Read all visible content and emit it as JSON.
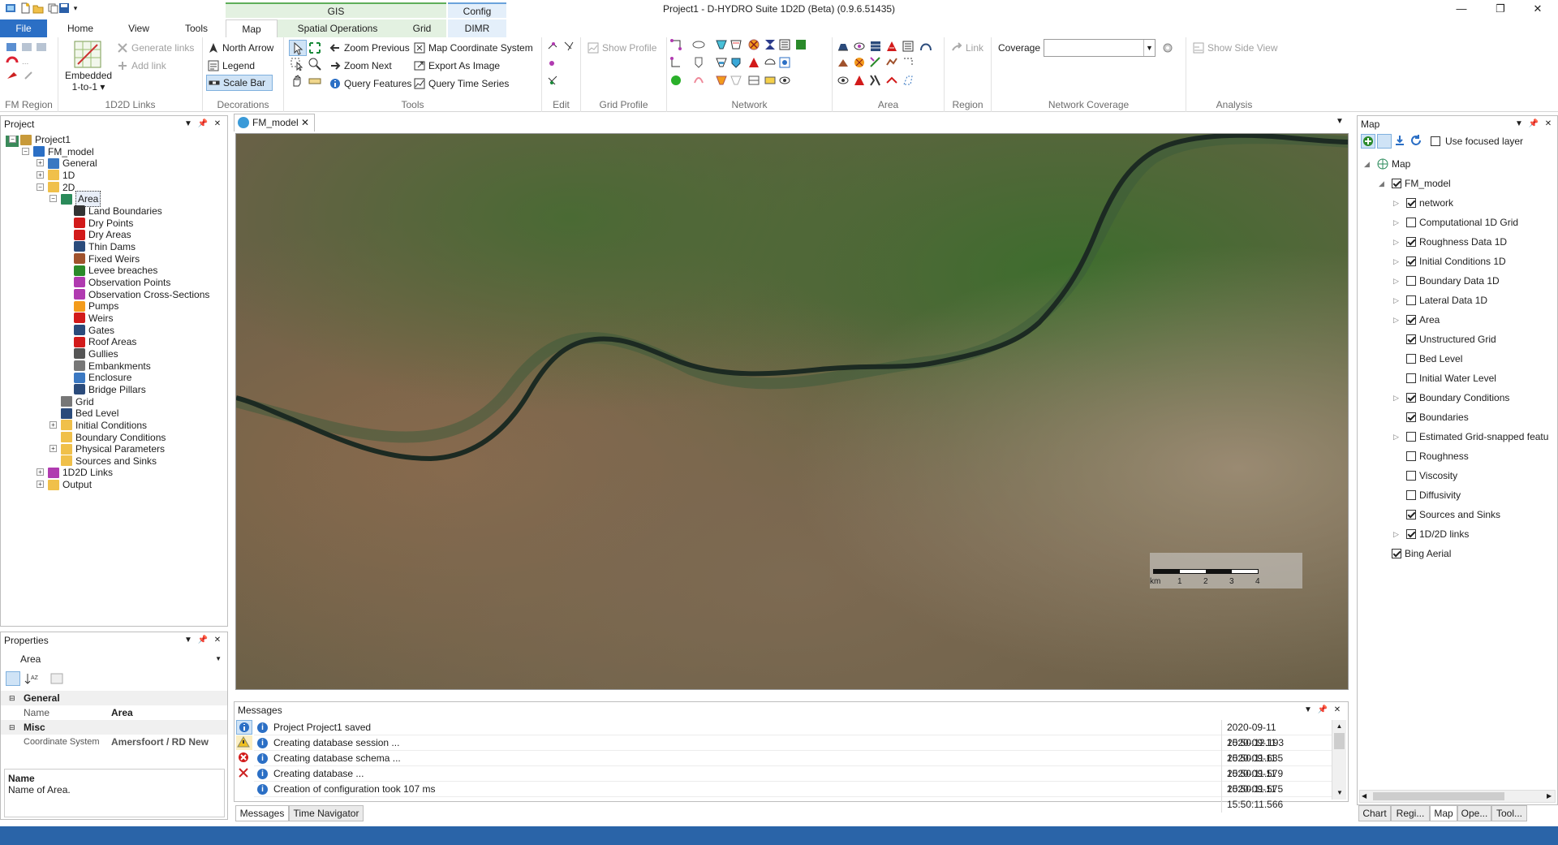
{
  "app": {
    "title": "Project1 - D-HYDRO Suite 1D2D (Beta) (0.9.6.51435)"
  },
  "window": {
    "minimize": "—",
    "restore": "❐",
    "close": "✕"
  },
  "ribbon": {
    "tabs": {
      "file": "File",
      "home": "Home",
      "view": "View",
      "tools": "Tools",
      "map": "Map",
      "spatial": "Spatial Operations",
      "grid": "Grid",
      "dimr": "DIMR"
    },
    "context": {
      "gis": "GIS",
      "config": "Config"
    },
    "groups": {
      "fm_region": "FM Region",
      "links": "1D2D Links",
      "decorations": "Decorations",
      "tools": "Tools",
      "edit": "Edit",
      "grid_profile": "Grid Profile",
      "network": "Network",
      "area": "Area",
      "region": "Region",
      "network_coverage": "Network Coverage",
      "analysis": "Analysis"
    },
    "links": {
      "embedded": "Embedded",
      "one_to_one": "1-to-1 ▾",
      "generate": "Generate links",
      "add": "Add link"
    },
    "decorations": {
      "north_arrow": "North Arrow",
      "legend": "Legend",
      "scale_bar": "Scale Bar"
    },
    "tools": {
      "zoom_previous": "Zoom Previous",
      "zoom_next": "Zoom Next",
      "query_features": "Query Features",
      "map_coord": "Map Coordinate System",
      "export_image": "Export As Image",
      "query_time": "Query Time Series"
    },
    "grid_profile": {
      "show_profile": "Show Profile"
    },
    "region": {
      "link": "Link"
    },
    "coverage": {
      "label": "Coverage",
      "value": ""
    },
    "analysis": {
      "show_side_view": "Show Side View"
    }
  },
  "project": {
    "title": "Project",
    "nodes": [
      {
        "label": "Project1"
      },
      {
        "label": "FM_model"
      },
      {
        "label": "General"
      },
      {
        "label": "1D"
      },
      {
        "label": "2D"
      },
      {
        "label": "Area"
      },
      {
        "label": "Land Boundaries"
      },
      {
        "label": "Dry Points"
      },
      {
        "label": "Dry Areas"
      },
      {
        "label": "Thin Dams"
      },
      {
        "label": "Fixed Weirs"
      },
      {
        "label": "Levee breaches"
      },
      {
        "label": "Observation Points"
      },
      {
        "label": "Observation Cross-Sections"
      },
      {
        "label": "Pumps"
      },
      {
        "label": "Weirs"
      },
      {
        "label": "Gates"
      },
      {
        "label": "Roof Areas"
      },
      {
        "label": "Gullies"
      },
      {
        "label": "Embankments"
      },
      {
        "label": "Enclosure"
      },
      {
        "label": "Bridge Pillars"
      },
      {
        "label": "Grid"
      },
      {
        "label": "Bed Level"
      },
      {
        "label": "Initial Conditions"
      },
      {
        "label": "Boundary Conditions"
      },
      {
        "label": "Physical Parameters"
      },
      {
        "label": "Sources and Sinks"
      },
      {
        "label": "1D2D Links"
      },
      {
        "label": "Output"
      }
    ]
  },
  "properties": {
    "title": "Properties",
    "selected": "Area",
    "sections": {
      "general": "General",
      "misc": "Misc"
    },
    "rows": {
      "name_key": "Name",
      "name_val": "Area",
      "cs_key": "Coordinate System",
      "cs_val": "Amersfoort / RD New"
    },
    "desc_title": "Name",
    "desc_text": "Name of Area."
  },
  "document": {
    "tab": "FM_model"
  },
  "scalebar": {
    "unit": "km",
    "ticks": [
      "1",
      "2",
      "3",
      "4"
    ]
  },
  "messages": {
    "title": "Messages",
    "rows": [
      {
        "text": "Project Project1 saved",
        "time": "2020-09-11 15:50:12.193"
      },
      {
        "text": "Creating database session ...",
        "time": "2020-09-11 15:50:11.635"
      },
      {
        "text": "Creating database schema ...",
        "time": "2020-09-11 15:50:11.579"
      },
      {
        "text": "Creating database ...",
        "time": "2020-09-11 15:50:11.575"
      },
      {
        "text": "Creation of configuration took 107 ms",
        "time": "2020-09-11 15:50:11.566"
      }
    ],
    "bottom_tabs": {
      "messages": "Messages",
      "time_navigator": "Time Navigator"
    }
  },
  "map_panel": {
    "title": "Map",
    "use_focused": "Use focused layer",
    "layers": [
      {
        "label": "Map",
        "checked": null
      },
      {
        "label": "FM_model",
        "checked": true
      },
      {
        "label": "network",
        "checked": true
      },
      {
        "label": "Computational 1D Grid",
        "checked": false
      },
      {
        "label": "Roughness Data 1D",
        "checked": true
      },
      {
        "label": "Initial Conditions 1D",
        "checked": true
      },
      {
        "label": "Boundary Data 1D",
        "checked": false
      },
      {
        "label": "Lateral Data 1D",
        "checked": false
      },
      {
        "label": "Area",
        "checked": true
      },
      {
        "label": "Unstructured Grid",
        "checked": true
      },
      {
        "label": "Bed Level",
        "checked": false
      },
      {
        "label": "Initial Water Level",
        "checked": false
      },
      {
        "label": "Boundary Conditions",
        "checked": true
      },
      {
        "label": "Boundaries",
        "checked": true
      },
      {
        "label": "Estimated Grid-snapped featu",
        "checked": false
      },
      {
        "label": "Roughness",
        "checked": false
      },
      {
        "label": "Viscosity",
        "checked": false
      },
      {
        "label": "Diffusivity",
        "checked": false
      },
      {
        "label": "Sources and Sinks",
        "checked": true
      },
      {
        "label": "1D/2D links",
        "checked": true
      },
      {
        "label": "Bing Aerial",
        "checked": true
      }
    ],
    "bottom_tabs": [
      "Chart",
      "Regi...",
      "Map",
      "Ope...",
      "Tool..."
    ]
  }
}
